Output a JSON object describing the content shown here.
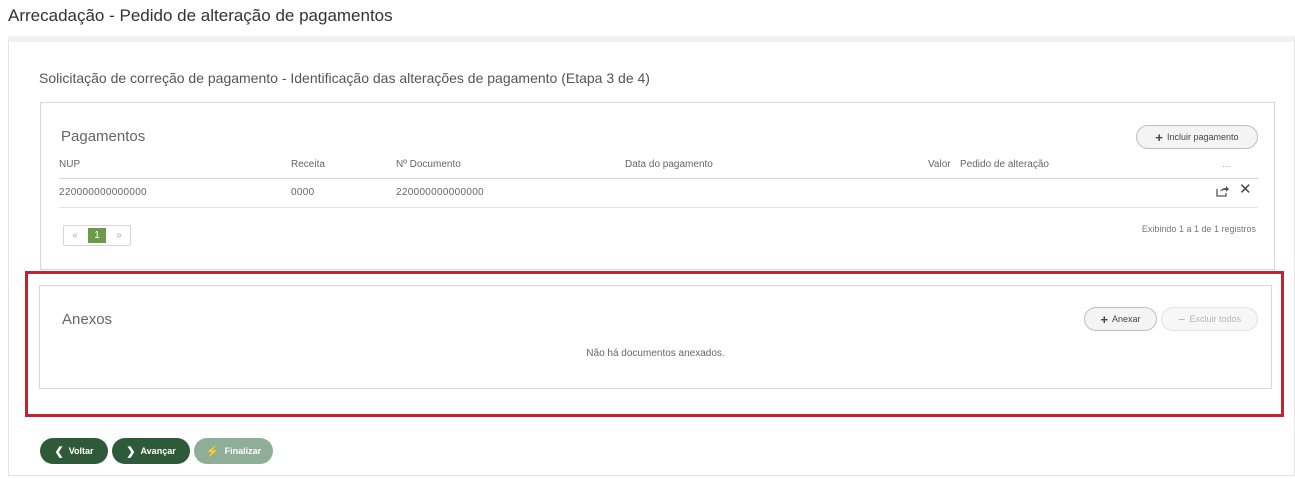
{
  "page": {
    "title": "Arrecadação - Pedido de alteração de pagamentos",
    "step_title": "Solicitação de correção de pagamento - Identificação das alterações de pagamento (Etapa 3 de 4)"
  },
  "pagamentos": {
    "title": "Pagamentos",
    "add_button": "Incluir pagamento",
    "columns": [
      "NUP",
      "Receita",
      "Nº Documento",
      "Data do pagamento",
      "Valor",
      "Pedido de alteração",
      "..."
    ],
    "rows": [
      {
        "nup": "220000000000000",
        "receita": "0000",
        "documento": "220000000000000",
        "data": "",
        "valor": "",
        "pedido": ""
      }
    ],
    "pager": {
      "prev": "«",
      "current": "1",
      "next": "»"
    },
    "records_info": "Exibindo 1 a 1 de 1 registros"
  },
  "anexos": {
    "title": "Anexos",
    "add_button": "Anexar",
    "delete_all_button": "Excluir todos",
    "empty_message": "Não há documentos anexados."
  },
  "footer": {
    "back": "Voltar",
    "next": "Avançar",
    "finish": "Finalizar"
  },
  "colors": {
    "highlight": "#c0242e",
    "primary_green": "#2f5a3a",
    "disabled_green": "#8fae97",
    "pager_active": "#6b9a4a"
  },
  "icons": [
    "plus-icon",
    "share-icon",
    "close-icon",
    "chevron-left-icon",
    "chevron-right-icon",
    "bolt-icon",
    "minus-icon"
  ]
}
